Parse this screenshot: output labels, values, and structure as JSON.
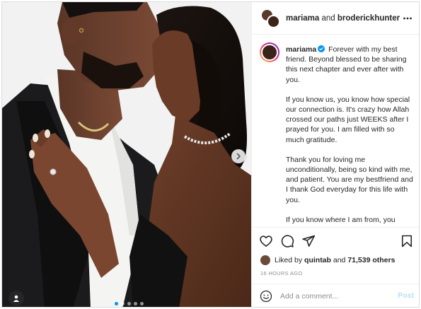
{
  "post": {
    "header": {
      "user1": "mariama",
      "connector": "and",
      "user2": "broderickhunter"
    },
    "caption": {
      "username": "mariama",
      "paragraphs": [
        "Forever with my best friend. Beyond blessed to be sharing this next chapter and ever after with you.",
        "If you know us, you know how special our connection is. It's crazy how Allah crossed our paths just WEEKS after I prayed for you. I am filled with so much gratitude.",
        "Thank you for loving me unconditionally, being so kind with me, and patient. You are my bestfriend and I thank God everyday for this life with you.",
        "If you know where I am from, you know how against the grain this is but"
      ]
    },
    "likes": {
      "prefix": "Liked by",
      "user": "quintab",
      "connector": "and",
      "count": "71,539 others"
    },
    "timestamp": "16 HOURS AGO",
    "comment": {
      "placeholder": "Add a comment...",
      "post_label": "Post"
    },
    "carousel": {
      "slide_count": 5,
      "active_index": 0
    }
  },
  "icons": {
    "more": "more-horizontal-icon",
    "verified": "verified-badge-icon",
    "like": "heart-icon",
    "comment": "comment-icon",
    "share": "send-icon",
    "save": "bookmark-icon",
    "emoji": "emoji-icon",
    "next": "chevron-right-icon",
    "tag": "user-tag-icon"
  },
  "colors": {
    "accent": "#0095f6",
    "post_button_disabled": "#b2dffc",
    "muted_text": "#8e8e8e",
    "text": "#262626"
  }
}
